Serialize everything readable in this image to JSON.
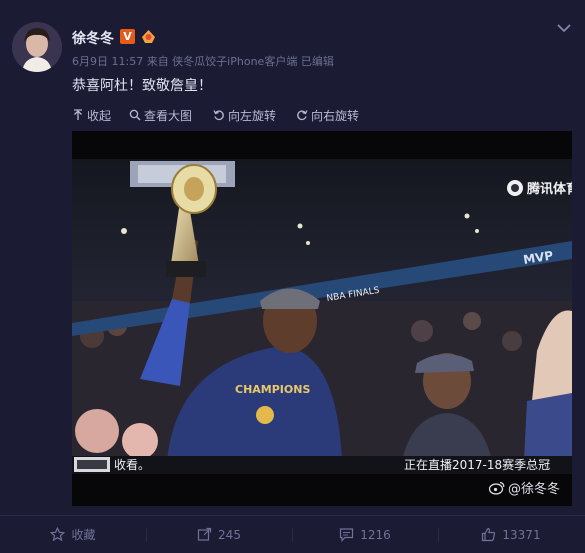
{
  "post": {
    "author": "徐冬冬",
    "verified_badge": "V",
    "meta": "6月9日 11:57 来自 侠冬瓜饺子iPhone客户端  已编辑",
    "text": "恭喜阿杜！致敬詹皇！"
  },
  "toolbar": {
    "collapse": "收起",
    "view_large": "查看大图",
    "rotate_left": "向左旋转",
    "rotate_right": "向右旋转"
  },
  "image": {
    "broadcaster_logo": "腾讯体育",
    "caption_left": "收看。",
    "caption_right": "正在直播2017-18赛季总冠",
    "shirt_text": "CHAMPIONS",
    "banner_text": "NBA FINALS",
    "mvp_text": "MVP",
    "watermark": "@徐冬冬"
  },
  "actions": {
    "favorite": "收藏",
    "repost": "245",
    "comment": "1216",
    "like": "13371"
  },
  "colors": {
    "background": "#1b1b33",
    "accent": "#e65b1a",
    "muted_text": "#6f7299"
  }
}
